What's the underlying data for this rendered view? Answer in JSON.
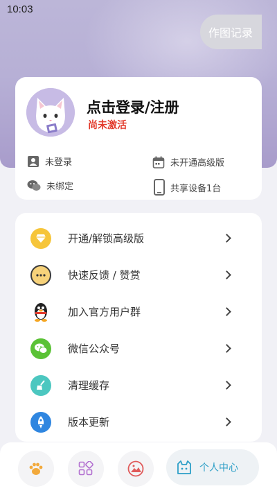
{
  "status_bar": {
    "time": "10:03"
  },
  "profile": {
    "login_title": "点击登录/注册",
    "activation_status": "尚未激活",
    "history_button": "作图记录",
    "info": {
      "login_state": "未登录",
      "premium_state": "未开通高级版",
      "wechat_state": "未绑定",
      "devices": "共享设备1台"
    }
  },
  "menu": {
    "items": [
      {
        "label": "开通/解锁高级版",
        "icon": "diamond-icon",
        "color": "#f6c53a"
      },
      {
        "label": "快速反馈 / 赞赏",
        "icon": "chat-bubble-icon",
        "color": "#f2a93b"
      },
      {
        "label": "加入官方用户群",
        "icon": "qq-penguin-icon",
        "color": "#222222"
      },
      {
        "label": "微信公众号",
        "icon": "wechat-icon",
        "color": "#5bc236"
      },
      {
        "label": "清理缓存",
        "icon": "broom-icon",
        "color": "#4cc7c0"
      },
      {
        "label": "版本更新",
        "icon": "rocket-icon",
        "color": "#2f86e0"
      }
    ]
  },
  "bottom_nav": {
    "active_label": "个人中心",
    "icons": [
      "paw-icon",
      "grid-apps-icon",
      "image-icon",
      "cat-icon"
    ],
    "accent": "#2d9fc7"
  }
}
